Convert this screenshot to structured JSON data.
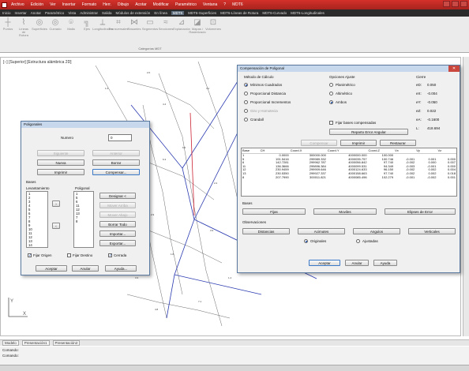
{
  "app": {
    "menu": [
      "Archivo",
      "Edición",
      "Ver",
      "Insertar",
      "Formato",
      "Herr.",
      "Dibujo",
      "Acotar",
      "Modificar",
      "Paramétrico",
      "Ventana",
      "?",
      "MDT6"
    ],
    "ribbon_tabs": [
      "Inicio",
      "Insertar",
      "Anotar",
      "Paramétrico",
      "Vista",
      "Administrar",
      "Salida",
      "Módulos de extensión",
      "En línea",
      "MDT6",
      "MDT6-Superficies",
      "MDT6-Líneas de Rotura",
      "MDT6-Curvado",
      "MDT6-Longitudinales"
    ],
    "ribbon_tools": [
      "Puntos",
      "Líneas de Rotura",
      "Superficies",
      "Curvado",
      "Malla",
      "Ejes",
      "Longitudinales",
      "Transversales",
      "Rasantes",
      "Segmentos",
      "Secciones",
      "Explanación",
      "Mapas / Rasterizado",
      "Volúmenes"
    ],
    "ribbon_panel_title": "Categorías MDT",
    "viewport_label": "[−] [Superior] [Estructura alámbrica 2D]",
    "layout_tabs": [
      "Modelo",
      "Presentación1",
      "Presentación2"
    ],
    "command_lines": [
      "Comando:",
      "Comando:"
    ]
  },
  "poligonales": {
    "title": "Poligonales",
    "numero_label": "Numero",
    "numero_value": "0",
    "buttons": {
      "siguiente": "Siguiente",
      "anterior": "Anterior",
      "nueva": "Nueva",
      "borrar": "Borrar",
      "imprimir": "Imprimir",
      "compensar": "Compensar..."
    },
    "bases_label": "Bases",
    "levantamiento_label": "Levantamiento",
    "poligonal_label": "Poligonal",
    "levantamiento_items": [
      "1",
      "2",
      "3",
      "4",
      "5",
      "6",
      "7",
      "8",
      "9",
      "10",
      "11",
      "12",
      "13",
      "14",
      "15",
      "16",
      "17",
      "18"
    ],
    "poligonal_items": [
      "1",
      "5",
      "6",
      "11",
      "12",
      "13",
      "7",
      "8"
    ],
    "side_buttons": {
      "designar": "Designar <",
      "mover_arriba": "Mover Arriba",
      "mover_abajo": "Mover Abajo",
      "borrar_todo": "Borrar Todo",
      "importar": "Importar...",
      "exportar": "Exportar..."
    },
    "fijar_origen": "Fijar Origen",
    "fijar_destino": "Fijar Destino",
    "cerrada": "Cerrada",
    "aceptar": "Aceptar",
    "anular": "Anular",
    "ayuda": "Ayuda..."
  },
  "compensacion": {
    "title": "Compensación de Poligonal",
    "metodo_label": "Método de Cálculo",
    "metodos": [
      "Mínimos Cuadrados",
      "Proporcional Distancia",
      "Proporcional Incrementos",
      "Giro y Homotecia",
      "Crandall"
    ],
    "opciones_label": "Opciones Ajuste",
    "opciones": [
      "Planimétrico",
      "Altimétrico",
      "Ambos"
    ],
    "fijar_bases": "Fijar bases compensadas",
    "reparto_button": "Reparto Error Angular",
    "cierre_label": "Cierre",
    "cierre": [
      {
        "k": "eD:",
        "v": "0.050"
      },
      {
        "k": "eX:",
        "v": "-0.004"
      },
      {
        "k": "eY:",
        "v": "-0.050"
      },
      {
        "k": "eZ:",
        "v": "0.022"
      },
      {
        "k": "eA:",
        "v": "-0.1600"
      },
      {
        "k": "L:",
        "v": "418.694"
      }
    ],
    "compensar": "Compensar",
    "imprimir": "Imprimir",
    "restaurar": "Restaurar",
    "table_headers": [
      "Base",
      "CH",
      "Coord.X",
      "Coord.Y",
      "Coord.Z",
      "Vx",
      "Vy",
      "Vz"
    ],
    "rows": [
      [
        "1",
        "0.0000",
        "300000.000",
        "4000000.000",
        "100.000",
        "",
        "",
        ""
      ],
      [
        "5",
        "191.5416",
        "299989.332",
        "4000035.757",
        "100.746",
        "-0.001",
        "0.001",
        "0.000"
      ],
      [
        "6",
        "142.7281",
        "299962.787",
        "4000056.842",
        "97.740",
        "-0.002",
        "0.000",
        "0.007"
      ],
      [
        "11",
        "136.3666",
        "299896.384",
        "4000099.531",
        "94.349",
        "-0.003",
        "-0.001",
        "0.000"
      ],
      [
        "12",
        "230.9459",
        "299909.646",
        "4000124.633",
        "96.150",
        "-0.002",
        "0.002",
        "0.004"
      ],
      [
        "13",
        "230.5350",
        "299927.337",
        "4000158.663",
        "97.740",
        "-0.002",
        "0.002",
        "0.018"
      ],
      [
        "8",
        "207.7990",
        "300011.821",
        "4000085.496",
        "102.279",
        "-0.001",
        "-0.002",
        "0.001"
      ]
    ],
    "bases_label": "Bases",
    "fijas": "Fijas",
    "moviles": "Moviles",
    "elipses": "Elipses de Error",
    "observaciones_label": "Observaciones",
    "distancias": "Distancias",
    "acimutes": "Acimutes",
    "angulos": "Angulos",
    "verticales": "Verticales",
    "originales": "Originales",
    "ajustadas": "Ajustadas",
    "aceptar": "Aceptar",
    "anular": "Anular",
    "ayuda": "Ayuda"
  }
}
